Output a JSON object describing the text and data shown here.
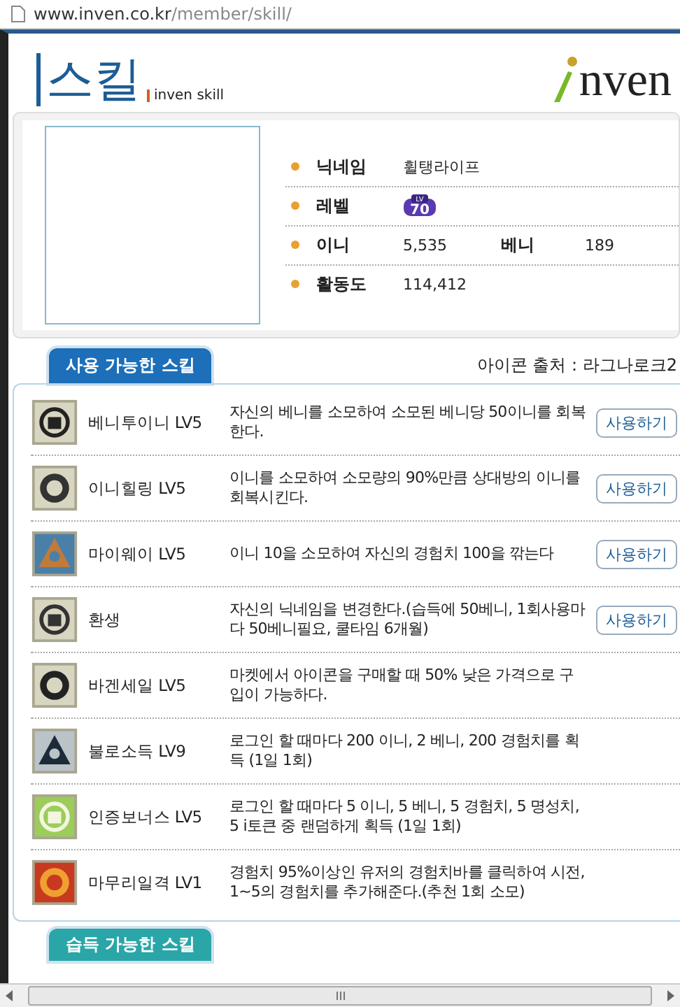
{
  "address_bar": {
    "host": "www.inven.co.kr",
    "path": "/member/skill/"
  },
  "header": {
    "title": "스킬",
    "subtitle": "inven skill",
    "logo_text": "nven"
  },
  "profile": {
    "rows": [
      {
        "kind": "text",
        "label": "닉네임",
        "value": "휠탱라이프"
      },
      {
        "kind": "badge",
        "label": "레벨",
        "badge": {
          "caption": "LV",
          "value": "70"
        }
      },
      {
        "kind": "pair",
        "label": "이니",
        "value": "5,535",
        "label2": "베니",
        "value2": "189"
      },
      {
        "kind": "text",
        "label": "활동도",
        "value": "114,412"
      }
    ]
  },
  "skills_tab": {
    "label": "사용 가능한 스킬",
    "selected": true
  },
  "icon_source": "아이콘 출처 : 라그나로크2",
  "skills": [
    {
      "name": "베니투이니 LV5",
      "description": "자신의 베니를 소모하여 소모된 베니당 50이니를 회복한다.",
      "button": "사용하기"
    },
    {
      "name": "이니힐링 LV5",
      "description": "이니를 소모하여 소모량의 90%만큼 상대방의 이니를 회복시킨다.",
      "button": "사용하기"
    },
    {
      "name": "마이웨이 LV5",
      "description": "이니 10을 소모하여 자신의 경험치 100을 깎는다",
      "button": "사용하기"
    },
    {
      "name": "환생",
      "description": "자신의 닉네임을 변경한다.(습득에 50베니, 1회사용마다 50베니필요, 쿨타임 6개월)",
      "button": "사용하기"
    },
    {
      "name": "바겐세일 LV5",
      "description": "마켓에서 아이콘을 구매할 때 50% 낮은 가격으로 구입이 가능하다."
    },
    {
      "name": "불로소득 LV9",
      "description": "로그인 할 때마다 200 이니, 2 베니, 200 경험치를 획득 (1일 1회)"
    },
    {
      "name": "인증보너스 LV5",
      "description": "로그인 할 때마다 5 이니, 5 베니, 5 경험치, 5 명성치, 5 i토큰 중 랜덤하게 획득 (1일 1회)"
    },
    {
      "name": "마무리일격 LV1",
      "description": "경험치 95%이상인 유저의 경험치바를 클릭하여 시전, 1~5의 경험치를 추가해준다.(추천 1회 소모)"
    }
  ],
  "learn_tab": {
    "label": "습득 가능한 스킬",
    "selected": false
  }
}
